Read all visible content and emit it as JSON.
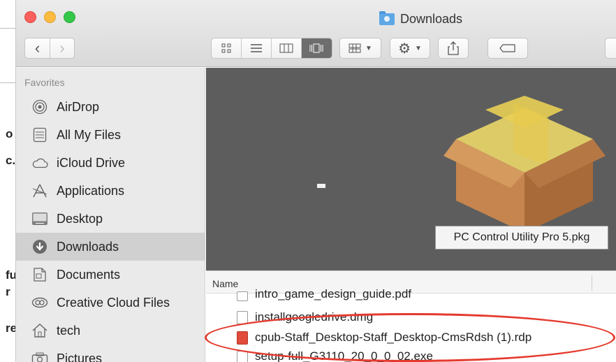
{
  "window": {
    "title": "Downloads"
  },
  "background_window": {
    "chars": [
      "o",
      "c.",
      "fu",
      "r",
      "re"
    ]
  },
  "toolbar": {
    "back": "‹",
    "forward": "›",
    "view_modes": [
      "icon-view",
      "list-view",
      "column-view",
      "coverflow-view"
    ],
    "active_view": "coverflow-view"
  },
  "sidebar": {
    "heading": "Favorites",
    "items": [
      {
        "label": "AirDrop",
        "icon": "airdrop-icon"
      },
      {
        "label": "All My Files",
        "icon": "all-files-icon"
      },
      {
        "label": "iCloud Drive",
        "icon": "cloud-icon"
      },
      {
        "label": "Applications",
        "icon": "applications-icon"
      },
      {
        "label": "Desktop",
        "icon": "desktop-icon"
      },
      {
        "label": "Downloads",
        "icon": "download-icon",
        "selected": true
      },
      {
        "label": "Documents",
        "icon": "documents-icon"
      },
      {
        "label": "Creative Cloud Files",
        "icon": "creative-cloud-icon"
      },
      {
        "label": "tech",
        "icon": "home-icon"
      },
      {
        "label": "Pictures",
        "icon": "camera-icon"
      }
    ]
  },
  "preview": {
    "file_label": "PC Control Utility Pro 5.pkg",
    "file_icon": "package-icon"
  },
  "file_list": {
    "column_name": "Name",
    "rows": [
      {
        "name": "intro_game_design_guide.pdf",
        "icon": "pdf-icon"
      },
      {
        "name": "installgoogledrive.dmg",
        "icon": "dmg-icon"
      },
      {
        "name": "cpub-Staff_Desktop-Staff_Desktop-CmsRdsh (1).rdp",
        "icon": "rdp-icon",
        "highlighted": true
      },
      {
        "name": "setup-full_G3110_20_0_0_02.exe",
        "icon": "exe-icon"
      }
    ]
  },
  "colors": {
    "selection": "#d0d0d0",
    "highlight_ring": "#e53a2e",
    "preview_bg": "#5d5d5d"
  }
}
